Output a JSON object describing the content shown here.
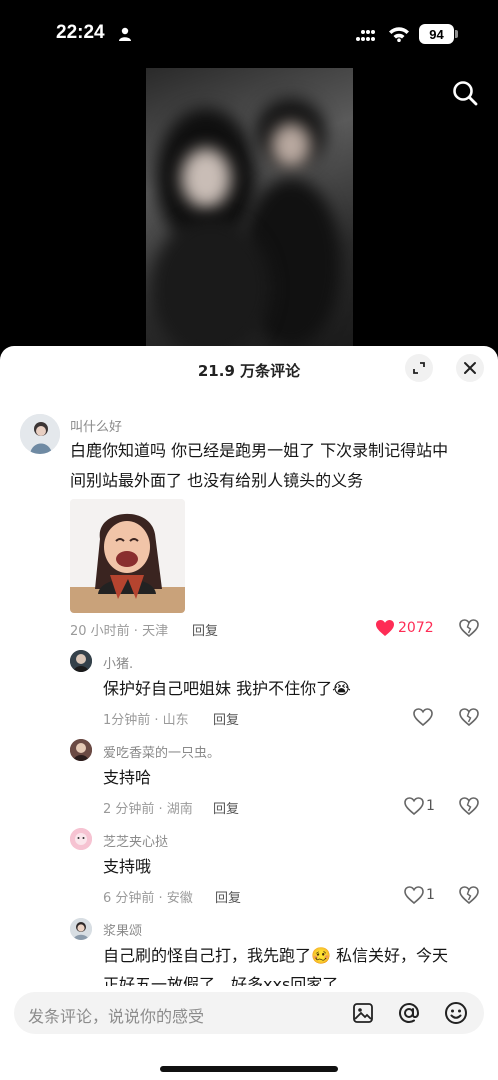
{
  "status_bar": {
    "time": "22:24",
    "battery": "94"
  },
  "sheet": {
    "title": "21.9 万条评论"
  },
  "comments": [
    {
      "user": "叫什么好",
      "text_line1": "白鹿你知道吗 你已经是跑男一姐了 下次录制记得站中",
      "text_line2": "间别站最外面了 也没有给别人镜头的义务",
      "meta": "20 小时前 · 天津",
      "reply": "回复",
      "likes": "2072"
    },
    {
      "user": "小猪.",
      "text": "保护好自己吧姐妹 我护不住你了😭",
      "meta": "1分钟前 · 山东",
      "reply": "回复",
      "likes": ""
    },
    {
      "user": "爱吃香菜的一只虫。",
      "text": "支持哈",
      "meta": "2 分钟前 · 湖南",
      "reply": "回复",
      "likes": "1"
    },
    {
      "user": "芝芝夹心挞",
      "text": "支持哦",
      "meta": "6 分钟前 · 安徽",
      "reply": "回复",
      "likes": "1"
    },
    {
      "user": "浆果颂",
      "text_line1": "自己刷的怪自己打，我先跑了🥴 私信关好，今天",
      "text_line2": "正好五一放假了，好多xxs回家了"
    }
  ],
  "input": {
    "placeholder": "发条评论，说说你的感受"
  },
  "colors": {
    "like_active": "#fe2c55",
    "sheet_bg": "#ffffff",
    "screen_bg": "#000000"
  }
}
